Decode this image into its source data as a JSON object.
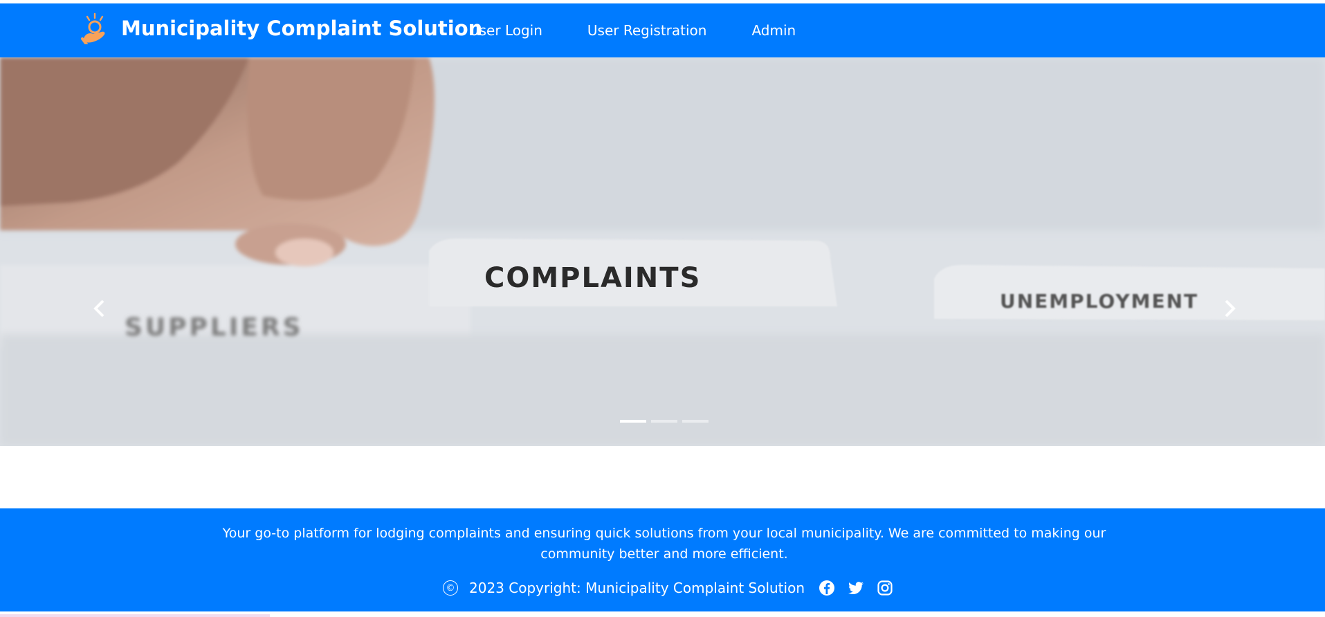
{
  "navbar": {
    "brand_name": "Municipality Complaint Solution",
    "links": [
      {
        "label": "User Login"
      },
      {
        "label": "User Registration"
      },
      {
        "label": "Admin"
      }
    ]
  },
  "carousel": {
    "slide_labels": {
      "folder_left": "SUPPLIERS",
      "folder_center": "COMPLAINTS",
      "folder_right": "UNEMPLOYMENT"
    },
    "indicator_count": 3,
    "active_index": 0,
    "prev_icon": "chevron-left-icon",
    "next_icon": "chevron-right-icon"
  },
  "footer": {
    "description": "Your go-to platform for lodging complaints and ensuring quick solutions from your local municipality. We are committed to making our community better and more efficient.",
    "copyright_symbol": "©",
    "copyright": "2023 Copyright: Municipality Complaint Solution",
    "social_icons": [
      "facebook-icon",
      "twitter-icon",
      "instagram-icon"
    ]
  },
  "colors": {
    "primary": "#007bff",
    "logo_orange": "#f7a25a",
    "text_on_primary": "#ffffff"
  }
}
